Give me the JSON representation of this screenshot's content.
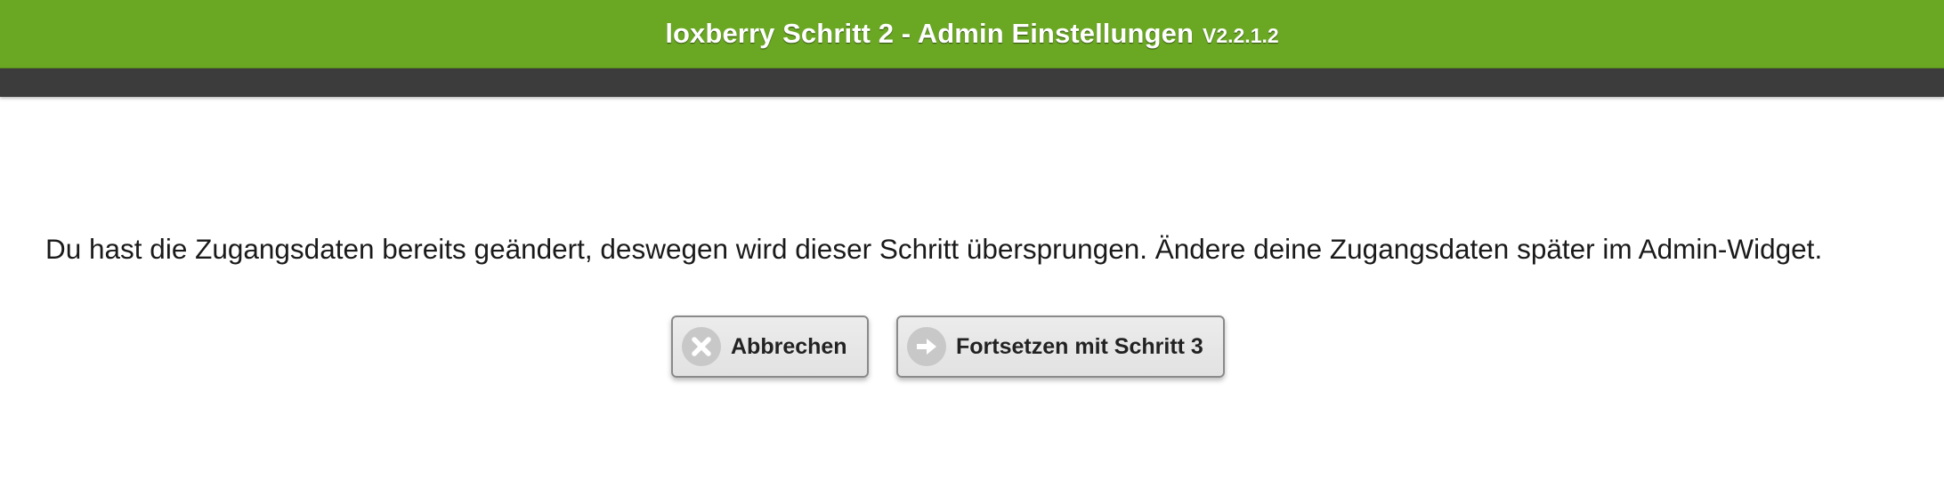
{
  "header": {
    "title": "loxberry Schritt 2 - Admin Einstellungen",
    "version": "V2.2.1.2"
  },
  "main": {
    "message": "Du hast die Zugangsdaten bereits geändert, deswegen wird dieser Schritt übersprungen. Ändere deine Zugangsdaten später im Admin-Widget."
  },
  "buttons": {
    "cancel_label": "Abbrechen",
    "cancel_icon": "close-icon",
    "next_label": "Fortsetzen mit Schritt 3",
    "next_icon": "arrow-right-icon"
  },
  "colors": {
    "header_bg": "#6aa823",
    "navbar_bg": "#3c3c3c",
    "button_bg": "#e6e6e6",
    "icon_circle": "#c8c8c8"
  }
}
